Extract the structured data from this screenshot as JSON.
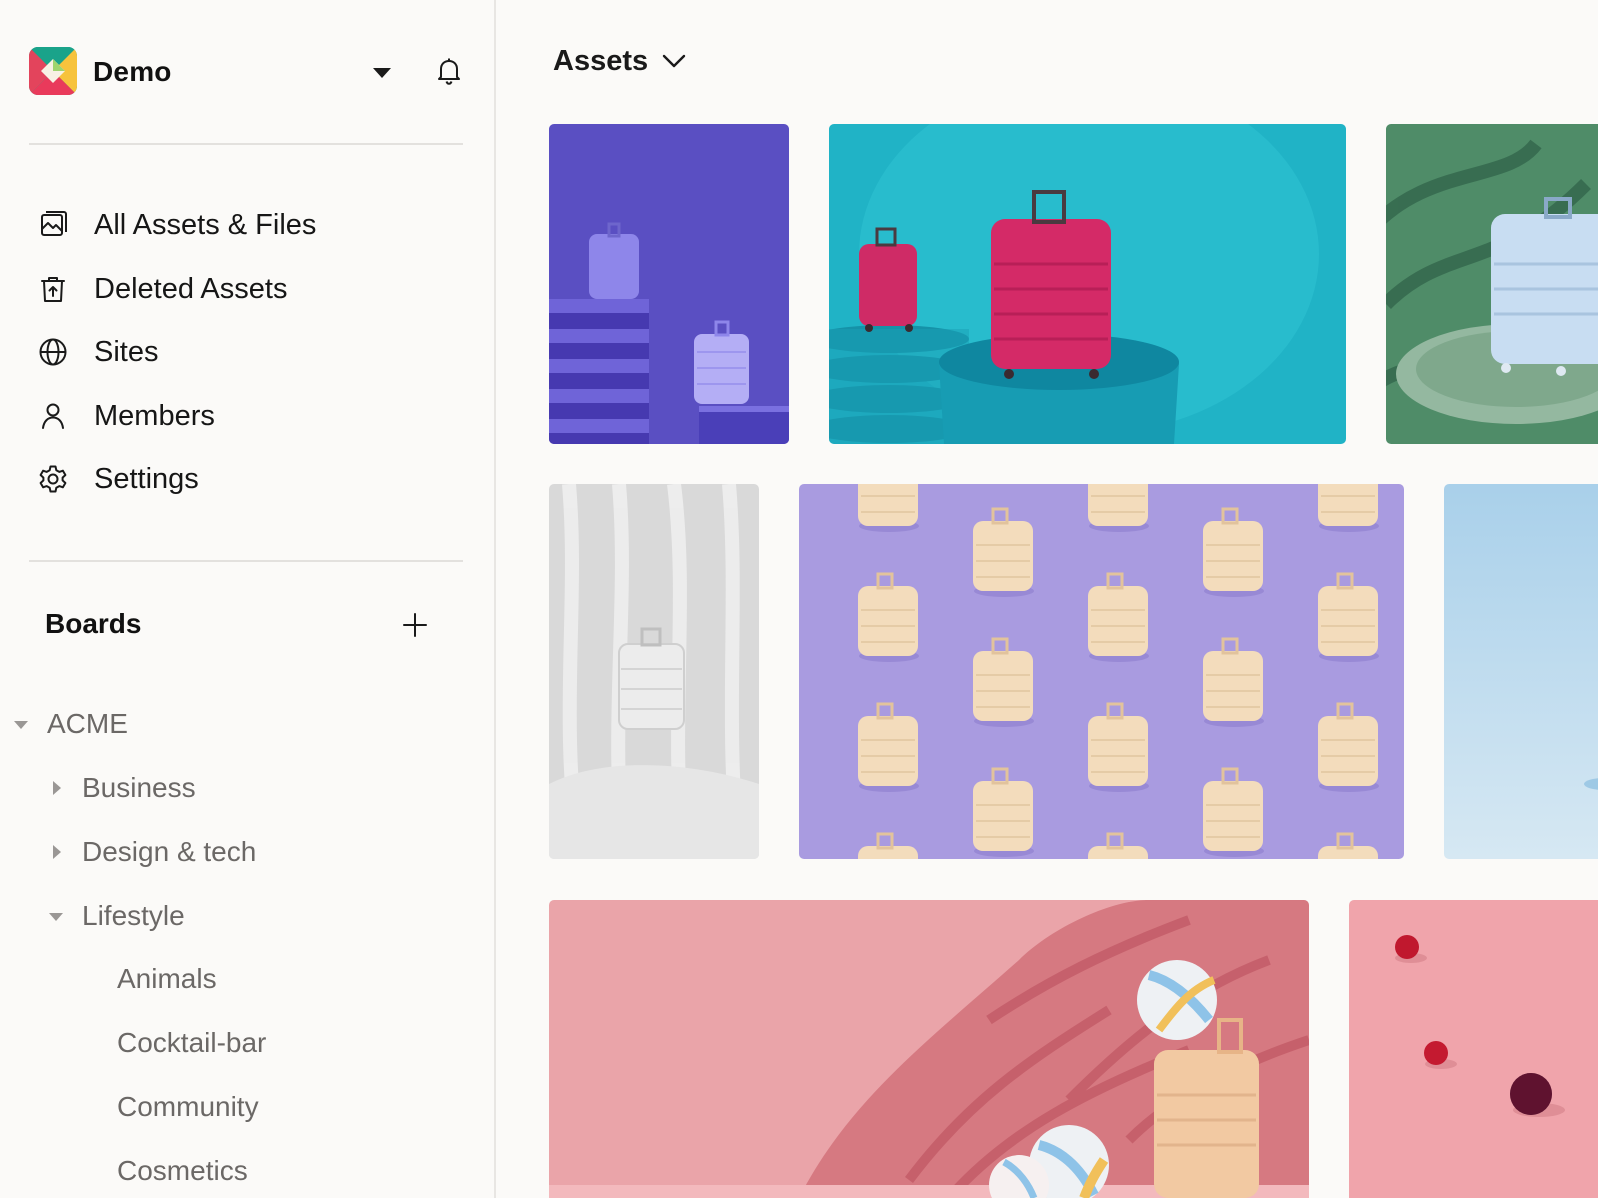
{
  "workspace": {
    "name": "Demo"
  },
  "nav": [
    {
      "label": "All Assets & Files",
      "icon": "assets-icon"
    },
    {
      "label": "Deleted Assets",
      "icon": "trash-icon"
    },
    {
      "label": "Sites",
      "icon": "globe-icon"
    },
    {
      "label": "Members",
      "icon": "user-icon"
    },
    {
      "label": "Settings",
      "icon": "gear-icon"
    }
  ],
  "boards": {
    "title": "Boards",
    "tree": [
      {
        "label": "ACME",
        "state": "expanded"
      },
      {
        "label": "Business",
        "state": "collapsed"
      },
      {
        "label": "Design & tech",
        "state": "collapsed"
      },
      {
        "label": "Lifestyle",
        "state": "expanded"
      },
      {
        "label": "Animals",
        "state": "leaf"
      },
      {
        "label": "Cocktail-bar",
        "state": "leaf"
      },
      {
        "label": "Community",
        "state": "leaf"
      },
      {
        "label": "Cosmetics",
        "state": "leaf"
      }
    ]
  },
  "main": {
    "title": "Assets"
  },
  "assets": [
    {
      "subject": "suitcases-on-purple-steps",
      "bg": "#5a4fc2"
    },
    {
      "subject": "pink-suitcase-on-teal-pedestal",
      "bg": "#1fb2c4"
    },
    {
      "subject": "white-suitcase-green-shadows",
      "bg": "#4d8b66"
    },
    {
      "subject": "white-suitcase-draped-fabric",
      "bg": "#dcdcdc"
    },
    {
      "subject": "cream-suitcases-pattern-lavender",
      "bg": "#a99be0"
    },
    {
      "subject": "pale-blue-backdrop",
      "bg": "#bfdcef"
    },
    {
      "subject": "suitcase-beach-balls-pink",
      "bg": "#e8a3a8"
    },
    {
      "subject": "red-balls-on-pink",
      "bg": "#f0a4ab"
    }
  ]
}
